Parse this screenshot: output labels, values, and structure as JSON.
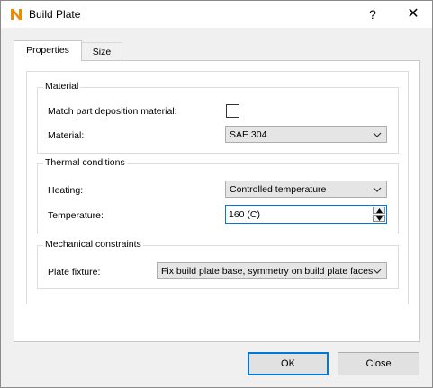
{
  "window": {
    "title": "Build Plate",
    "help_label": "?",
    "close_label": "✕",
    "app_icon": "nx-logo-icon",
    "accent_color": "#0078d7"
  },
  "tabs": [
    {
      "label": "Properties",
      "active": true
    },
    {
      "label": "Size",
      "active": false
    }
  ],
  "material_group": {
    "title": "Material",
    "match_label": "Match part deposition material:",
    "match_checked": false,
    "material_label": "Material:",
    "material_value": "SAE 304"
  },
  "thermal_group": {
    "title": "Thermal conditions",
    "heating_label": "Heating:",
    "heating_value": "Controlled temperature",
    "temperature_label": "Temperature:",
    "temperature_value": "160 (C)"
  },
  "mechanical_group": {
    "title": "Mechanical constraints",
    "fixture_label": "Plate fixture:",
    "fixture_value": "Fix build plate base, symmetry on build plate faces"
  },
  "buttons": {
    "ok": "OK",
    "close": "Close"
  }
}
